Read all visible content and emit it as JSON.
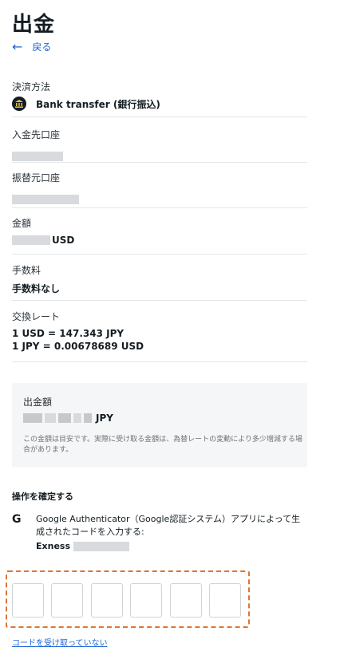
{
  "page": {
    "title": "出金",
    "back_label": "戻る"
  },
  "payment_method": {
    "label": "決済方法",
    "value": "Bank transfer (銀行振込)",
    "icon": "bank-icon"
  },
  "deposit_account": {
    "label": "入金先口座"
  },
  "source_account": {
    "label": "振替元口座"
  },
  "amount": {
    "label": "金額",
    "currency": "USD"
  },
  "fee": {
    "label": "手数料",
    "value": "手数料なし"
  },
  "exchange_rate": {
    "label": "交換レート",
    "line1": "1 USD = 147.343 JPY",
    "line2": "1 JPY = 0.00678689 USD"
  },
  "withdrawal_summary": {
    "label": "出金額",
    "currency": "JPY",
    "note": "この金額は目安です。実際に受け取る金額は、為替レートの変動により多少増減する場合があります。"
  },
  "confirm": {
    "title": "操作を確定する",
    "google_logo": "G",
    "instruction": "Google Authenticator（Google認証システム）アプリによって生成されたコードを入力する:",
    "account_prefix": "Exness",
    "code_length": 6,
    "no_code_link": "コードを受け取っていない"
  },
  "colors": {
    "link": "#1d63d8",
    "highlight_border": "#e0742f"
  }
}
